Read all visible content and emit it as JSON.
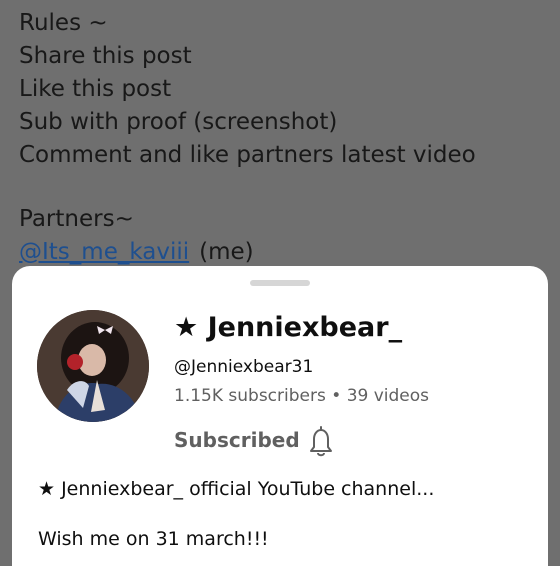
{
  "post": {
    "lines": [
      "Rules ~",
      "Share this post",
      "Like this post",
      "Sub with proof (screenshot)",
      "Comment and like partners latest video",
      "Partners~"
    ],
    "partner_mention": "@Its_me_kaviii",
    "partner_suffix": "(me)"
  },
  "channel": {
    "name": "★ Jenniexbear_",
    "handle": "@Jenniexbear31",
    "subscribers": "1.15K subscribers",
    "separator": " • ",
    "videos": "39 videos",
    "subscribe_label": "Subscribed",
    "description": "★ Jenniexbear_ official YouTube channel...",
    "wish": "Wish me on 31 march!!!"
  },
  "colors": {
    "overlay": "#6f6f6f",
    "mention": "#1e4f8f",
    "sheet": "#ffffff",
    "muted": "#606060"
  },
  "icons": {
    "bell": "bell-icon",
    "avatar": "channel-avatar"
  }
}
